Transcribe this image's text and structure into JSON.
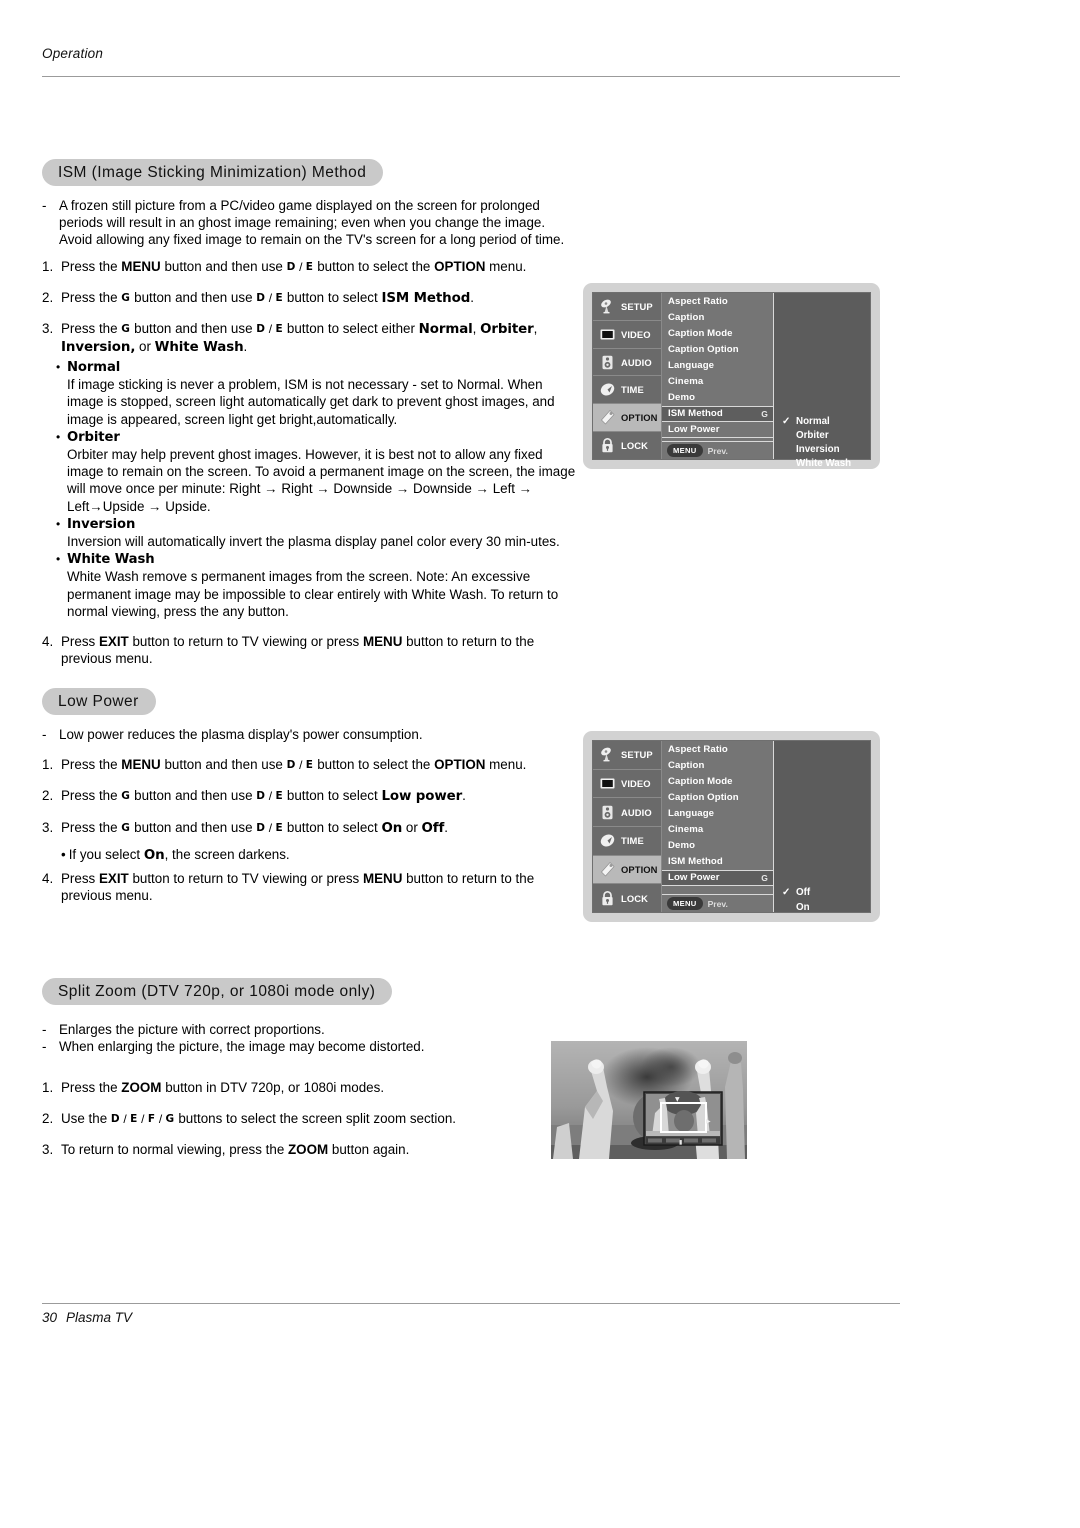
{
  "page": {
    "running_head": "Operation",
    "footer_page_number": "30",
    "footer_label": "Plasma TV"
  },
  "sections": {
    "ism": {
      "heading": "ISM (Image Sticking Minimization) Method",
      "intro_dash": "A frozen still picture from a PC/video game displayed on the screen for prolonged periods will result in an ghost image remaining; even when you change the image. Avoid allowing any fixed image to remain on the TV's screen for a long period of time.",
      "step1": {
        "marker": "1.",
        "a": "Press the ",
        "menu": "MENU",
        "b": " button and then use ",
        "arrow1": "D",
        "slash": " / ",
        "arrow2": "E",
        "c": " button to select the ",
        "option": "OPTION",
        "d": " menu."
      },
      "step2": {
        "marker": "2.",
        "a": "Press the ",
        "g": "G",
        "b": " button and then use ",
        "arrow1": "D",
        "slash": " / ",
        "arrow2": "E",
        "c": " button to select ",
        "target": "ISM Method",
        "d": "."
      },
      "step3": {
        "marker": "3.",
        "a": "Press the ",
        "g": "G",
        "b": " button and then use ",
        "arrow1": "D",
        "slash": " / ",
        "arrow2": "E",
        "c": " button to select either ",
        "o1": "Normal",
        "sep1": ", ",
        "o2": "Orbiter",
        "sep2": ",",
        "o3": "Inversion,",
        "sep3": " or ",
        "o4": "White Wash",
        "d": "."
      },
      "bullets": [
        {
          "title": "Normal",
          "body": "If image sticking is never a problem, ISM is not necessary - set to Normal. When image is stopped, screen light automatically get dark to prevent ghost images, and image is appeared, screen light get bright,automatically."
        },
        {
          "title": "Orbiter",
          "body": "Orbiter may help prevent ghost images. However, it is best not to allow any fixed image to remain on the screen. To avoid a permanent image on the screen, the image will move once per minute: Right → Right → Downside → Downside → Left → Left→Upside  → Upside."
        },
        {
          "title": "Inversion",
          "body": "Inversion will automatically invert the plasma display panel color every 30 min-utes."
        },
        {
          "title": "White Wash",
          "body": "White Wash remove s permanent images from the screen. Note: An excessive permanent image may be impossible to clear entirely with White Wash. To return to normal viewing, press the any button."
        }
      ],
      "step4": {
        "marker": "4.",
        "a": "Press ",
        "exit": "EXIT",
        "b": " button to return to TV viewing or press ",
        "menu": "MENU",
        "c": " button to return to the previous menu."
      }
    },
    "low_power": {
      "heading": "Low Power",
      "intro_dash": "Low power reduces the plasma display's power consumption.",
      "step1": {
        "marker": "1.",
        "a": "Press the ",
        "menu": "MENU",
        "b": " button and then use ",
        "arrow1": "D",
        "slash": " / ",
        "arrow2": "E",
        "c": " button to select the ",
        "option": "OPTION",
        "d": " menu."
      },
      "step2": {
        "marker": "2.",
        "a": "Press the ",
        "g": "G",
        "b": " button and then use ",
        "arrow1": "D",
        "slash": " / ",
        "arrow2": "E",
        "c": " button to select ",
        "target": "Low power",
        "d": "."
      },
      "step3": {
        "marker": "3.",
        "a": "Press the ",
        "g": "G",
        "b": " button and then use ",
        "arrow1": "D",
        "slash": " / ",
        "arrow2": "E",
        "c": " button to select ",
        "on": "On",
        "sep": " or ",
        "off": "Off",
        "d": "."
      },
      "note": {
        "a": "If you select ",
        "on": "On",
        "b": ", the screen darkens."
      },
      "step4": {
        "marker": "4.",
        "a": "Press ",
        "exit": "EXIT",
        "b": " button to return to TV viewing or press ",
        "menu": "MENU",
        "c": " button to return to the previous menu."
      }
    },
    "split_zoom": {
      "heading": "Split Zoom (DTV 720p, or 1080i mode only)",
      "dash1": "Enlarges the picture with correct proportions.",
      "dash2": "When enlarging the picture, the image may become distorted.",
      "step1": {
        "marker": "1.",
        "a": "Press the ",
        "zoom": "ZOOM",
        "b": " button in DTV 720p, or 1080i modes."
      },
      "step2": {
        "marker": "2.",
        "a": "Use the ",
        "k1": "D",
        "s1": " / ",
        "k2": "E",
        "s2": " / ",
        "k3": "F",
        "s3": " / ",
        "k4": "G",
        "b": " buttons to select the screen split zoom section."
      },
      "step3": {
        "marker": "3.",
        "a": "To return to normal viewing, press the ",
        "zoom": "ZOOM",
        "b": " button again."
      }
    }
  },
  "osd_ism": {
    "sidebar": [
      {
        "label": "SETUP",
        "icon": "satellite-dish-icon",
        "active": false
      },
      {
        "label": "VIDEO",
        "icon": "tv-screen-icon",
        "active": false
      },
      {
        "label": "AUDIO",
        "icon": "speaker-icon",
        "active": false
      },
      {
        "label": "TIME",
        "icon": "clock-icon",
        "active": false
      },
      {
        "label": "OPTION",
        "icon": "tag-icon",
        "active": true
      },
      {
        "label": "LOCK",
        "icon": "padlock-icon",
        "active": false
      }
    ],
    "menu_items": [
      {
        "label": "Aspect Ratio",
        "arrow": "",
        "selected": false
      },
      {
        "label": "Caption",
        "arrow": "",
        "selected": false
      },
      {
        "label": "Caption Mode",
        "arrow": "",
        "selected": false
      },
      {
        "label": "Caption Option",
        "arrow": "",
        "selected": false
      },
      {
        "label": "Language",
        "arrow": "",
        "selected": false
      },
      {
        "label": "Cinema",
        "arrow": "",
        "selected": false
      },
      {
        "label": "Demo",
        "arrow": "",
        "selected": false
      },
      {
        "label": "ISM Method",
        "arrow": "G",
        "selected": true
      },
      {
        "label": "Low Power",
        "arrow": "",
        "selected": false
      }
    ],
    "menu_footer": {
      "button": "MENU",
      "label": "Prev."
    },
    "options": [
      {
        "label": "Normal",
        "checked": true
      },
      {
        "label": "Orbiter",
        "checked": false
      },
      {
        "label": "Inversion",
        "checked": false
      },
      {
        "label": "White Wash",
        "checked": false
      }
    ],
    "check_glyph": "✓"
  },
  "osd_lowpower": {
    "sidebar": [
      {
        "label": "SETUP",
        "icon": "satellite-dish-icon",
        "active": false
      },
      {
        "label": "VIDEO",
        "icon": "tv-screen-icon",
        "active": false
      },
      {
        "label": "AUDIO",
        "icon": "speaker-icon",
        "active": false
      },
      {
        "label": "TIME",
        "icon": "clock-icon",
        "active": false
      },
      {
        "label": "OPTION",
        "icon": "tag-icon",
        "active": true
      },
      {
        "label": "LOCK",
        "icon": "padlock-icon",
        "active": false
      }
    ],
    "menu_items": [
      {
        "label": "Aspect Ratio",
        "arrow": "",
        "selected": false
      },
      {
        "label": "Caption",
        "arrow": "",
        "selected": false
      },
      {
        "label": "Caption Mode",
        "arrow": "",
        "selected": false
      },
      {
        "label": "Caption Option",
        "arrow": "",
        "selected": false
      },
      {
        "label": "Language",
        "arrow": "",
        "selected": false
      },
      {
        "label": "Cinema",
        "arrow": "",
        "selected": false
      },
      {
        "label": "Demo",
        "arrow": "",
        "selected": false
      },
      {
        "label": "ISM Method",
        "arrow": "",
        "selected": false
      },
      {
        "label": "Low Power",
        "arrow": "G",
        "selected": true
      }
    ],
    "menu_footer": {
      "button": "MENU",
      "label": "Prev."
    },
    "options": [
      {
        "label": "Off",
        "checked": true
      },
      {
        "label": "On",
        "checked": false
      }
    ],
    "check_glyph": "✓"
  },
  "colors": {
    "pill_background": "#c9c9c9",
    "osd_frame": "#d2d2d2",
    "osd_panel": "#5c5c5c",
    "osd_sidebar": "#6a6a6a",
    "osd_menu": "#757575",
    "osd_active": "#b9b9b9",
    "rule": "#9b9b9b"
  }
}
